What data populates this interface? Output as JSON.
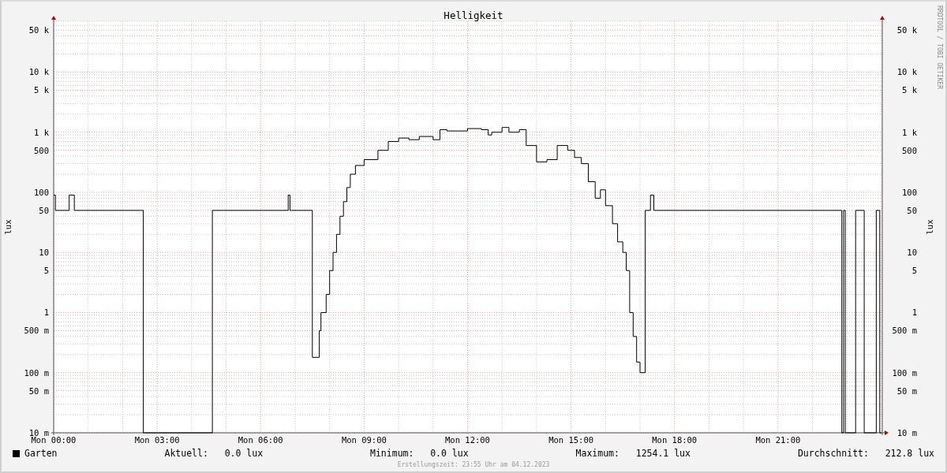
{
  "graph": {
    "title": "Helligkeit",
    "left_axis": {
      "label": "lux",
      "tick_labels": [
        "50 k",
        "10 k",
        "5 k",
        "1 k",
        "500",
        "100",
        "50",
        "10",
        "5",
        "1",
        "500 m",
        "100 m",
        "50 m",
        "10 m"
      ]
    },
    "right_axis": {
      "label": "lux",
      "tick_labels": [
        "50 k",
        "10 k",
        "5 k",
        "1 k",
        "500",
        "100",
        "50",
        "10",
        "5",
        "1",
        "500 m",
        "100 m",
        "50 m",
        "10 m"
      ]
    },
    "x_tick_labels": [
      "Mon 00:00",
      "Mon 03:00",
      "Mon 06:00",
      "Mon 09:00",
      "Mon 12:00",
      "Mon 15:00",
      "Mon 18:00",
      "Mon 21:00"
    ],
    "credit": "RRDTOOL / TOBI OETIKER",
    "legend": {
      "series": "Garten",
      "color": "#000000",
      "stats": [
        {
          "label": "Aktuell:",
          "value": "0.0 lux"
        },
        {
          "label": "Minimum:",
          "value": "0.0 lux"
        },
        {
          "label": "Maximum:",
          "value": "1254.1 lux"
        },
        {
          "label": "Durchschnitt:",
          "value": "212.8 lux"
        }
      ]
    },
    "footer": "Erstellungszeit: 23:55 Uhr am 04.12.2023"
  }
}
